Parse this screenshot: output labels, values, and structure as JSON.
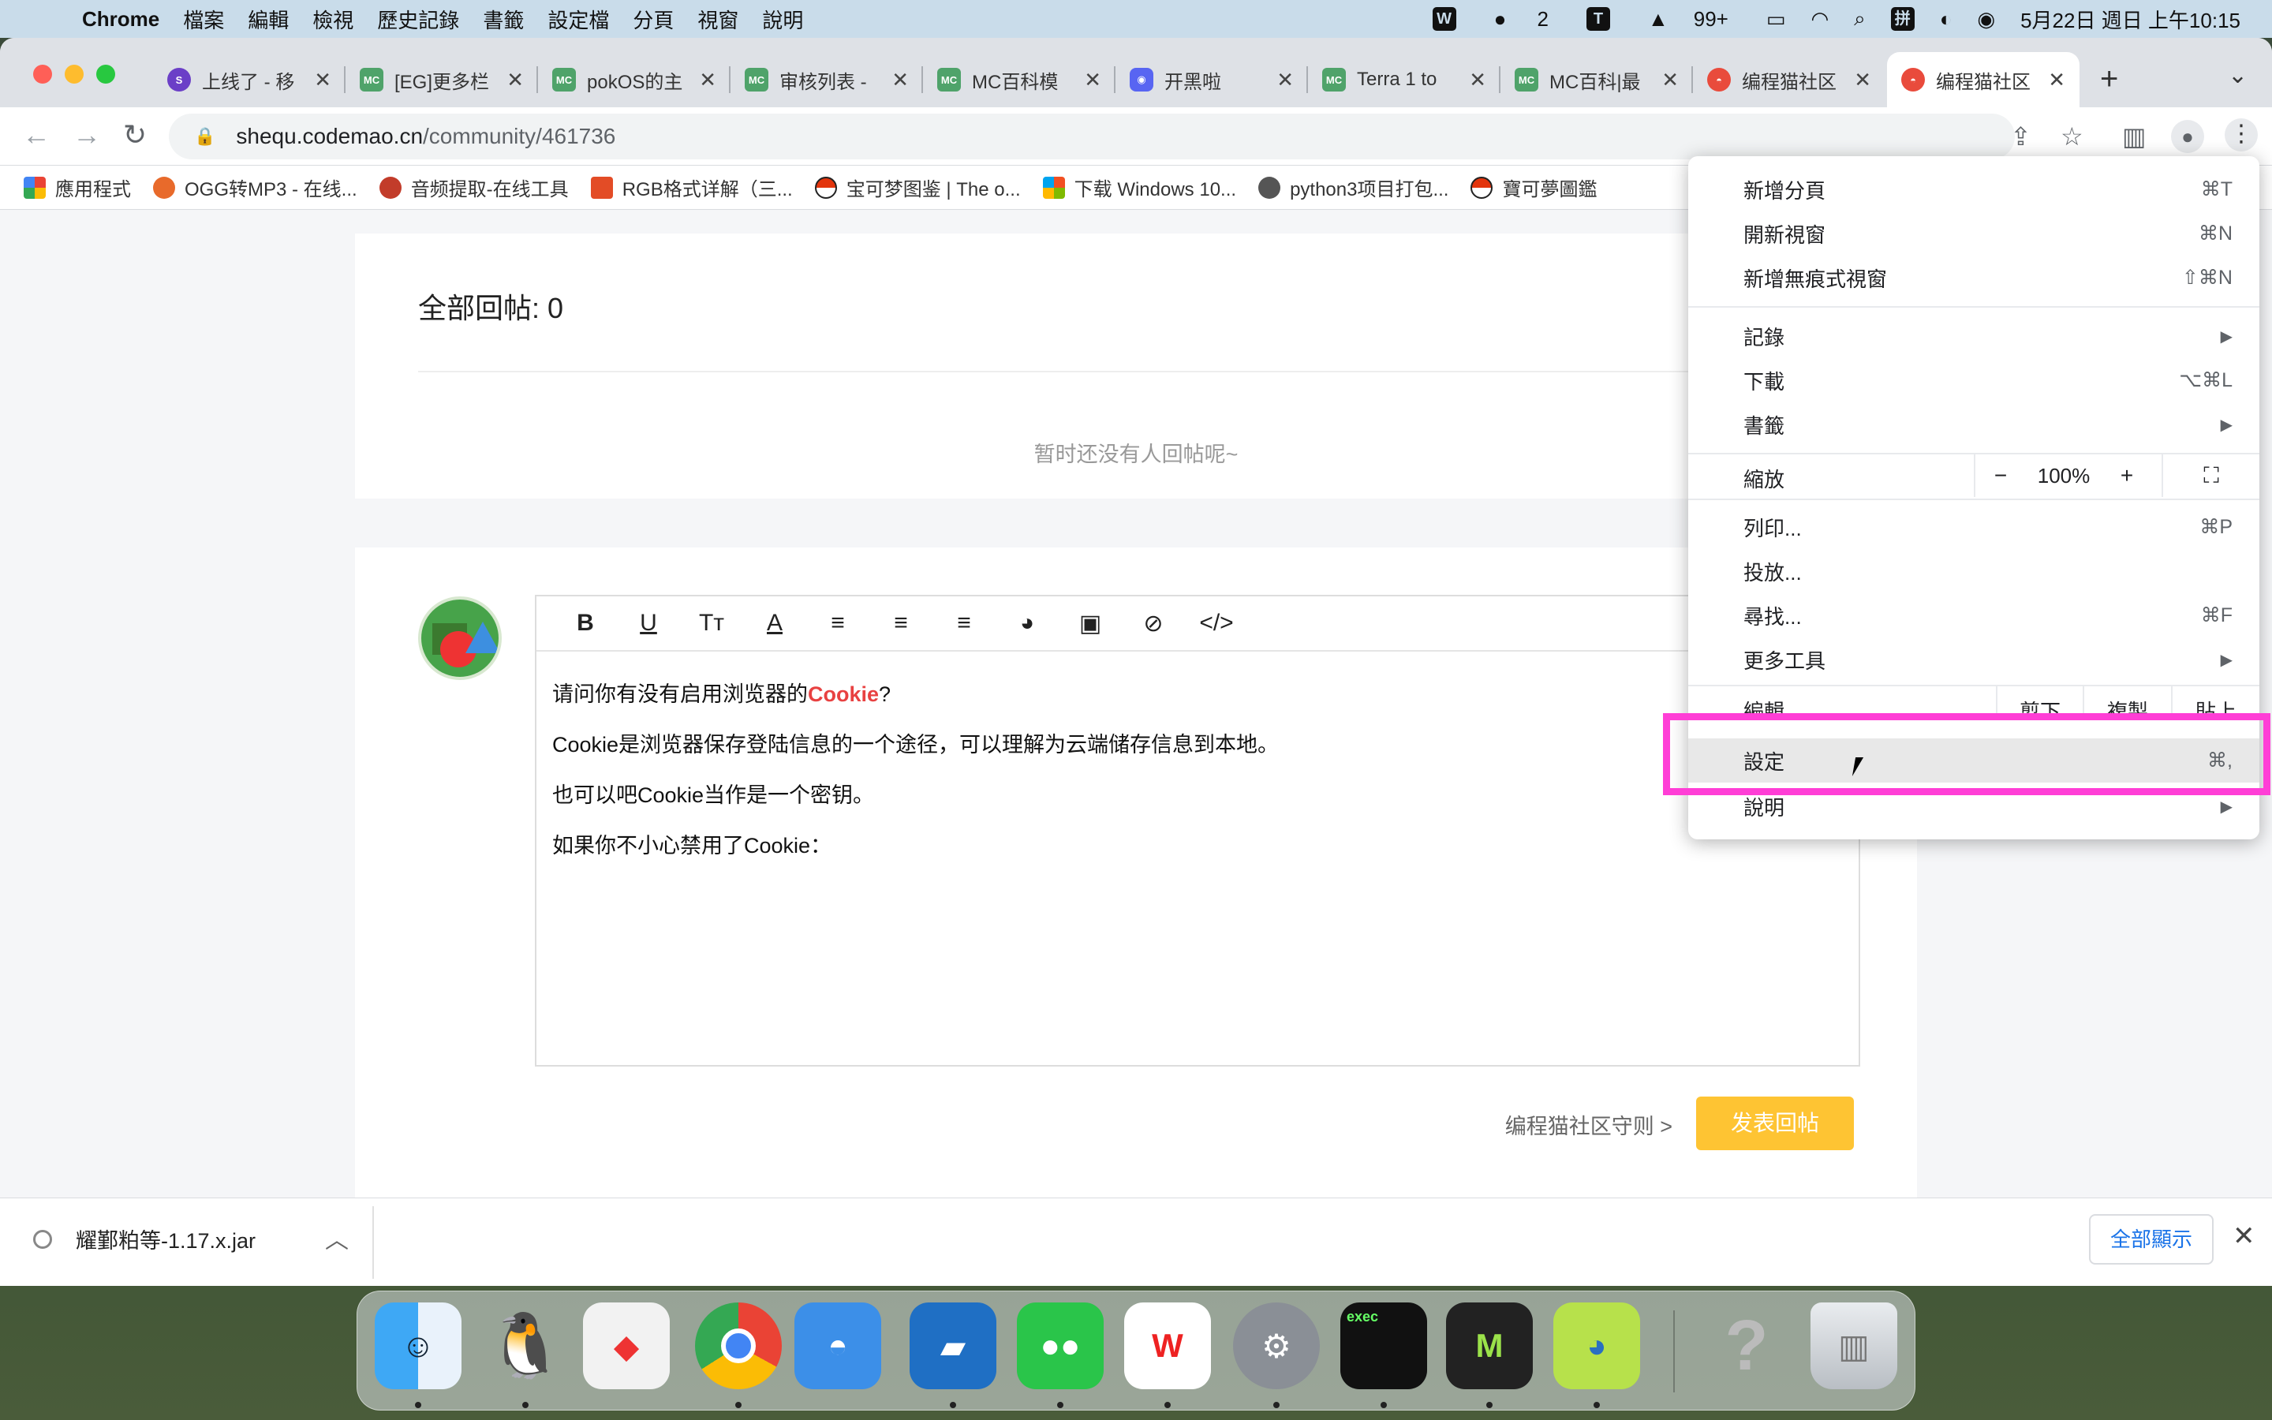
{
  "menubar": {
    "app": "Chrome",
    "items": [
      "檔案",
      "編輯",
      "檢視",
      "歷史記錄",
      "書籤",
      "設定檔",
      "分頁",
      "視窗",
      "說明"
    ],
    "wechat_count": "2",
    "qq_count": "99+",
    "ime": "拼",
    "clock": "5月22日 週日 上午10:15"
  },
  "tabs": [
    {
      "favicon": "s",
      "title": "上线了 - 移"
    },
    {
      "favicon": "MC",
      "title": "[EG]更多栏"
    },
    {
      "favicon": "MC",
      "title": "pokOS的主"
    },
    {
      "favicon": "MC",
      "title": "审核列表 -"
    },
    {
      "favicon": "MC",
      "title": "MC百科模"
    },
    {
      "favicon": "discord",
      "title": "开黑啦"
    },
    {
      "favicon": "MC",
      "title": "Terra 1 to"
    },
    {
      "favicon": "MC",
      "title": "MC百科|最"
    },
    {
      "favicon": "cat",
      "title": "编程猫社区"
    },
    {
      "favicon": "cat",
      "title": "编程猫社区"
    }
  ],
  "address": {
    "host": "shequ.codemao.cn",
    "path": "/community/461736"
  },
  "bookmarks": [
    {
      "icon": "apps",
      "label": "應用程式"
    },
    {
      "icon": "ogg",
      "label": "OGG转MP3 - 在线..."
    },
    {
      "icon": "mus",
      "label": "音频提取-在线工具"
    },
    {
      "icon": "rgb",
      "label": "RGB格式详解（三..."
    },
    {
      "icon": "poke",
      "label": "宝可梦图鉴 | The o..."
    },
    {
      "icon": "win",
      "label": "下载 Windows 10..."
    },
    {
      "icon": "py",
      "label": "python3项目打包..."
    },
    {
      "icon": "poke",
      "label": "寶可夢圖鑑"
    }
  ],
  "page": {
    "reply_count": "全部回帖: 0",
    "no_reply": "暂时还没有人回帖呢~",
    "editor": {
      "line1_pre": "请问你有没有启用浏览器的",
      "line1_kw": "Cookie",
      "line1_post": "?",
      "line2": "Cookie是浏览器保存登陆信息的一个途径，可以理解为云端储存信息到本地。",
      "line3": "也可以吧Cookie当作是一个密钥。",
      "line4": "如果你不小心禁用了Cookie："
    },
    "rules_link": "编程猫社区守则 >",
    "submit": "发表回帖"
  },
  "download": {
    "filename": "耀鄞粕等-1.17.x.jar",
    "show_all": "全部顯示"
  },
  "chrome_menu": {
    "new_tab": {
      "label": "新增分頁",
      "shortcut": "⌘T"
    },
    "new_window": {
      "label": "開新視窗",
      "shortcut": "⌘N"
    },
    "incognito": {
      "label": "新增無痕式視窗",
      "shortcut": "⇧⌘N"
    },
    "history": {
      "label": "記錄"
    },
    "downloads": {
      "label": "下載",
      "shortcut": "⌥⌘L"
    },
    "bookmarks": {
      "label": "書籤"
    },
    "zoom": {
      "label": "縮放",
      "minus": "−",
      "value": "100%",
      "plus": "+"
    },
    "print": {
      "label": "列印...",
      "shortcut": "⌘P"
    },
    "cast": {
      "label": "投放..."
    },
    "find": {
      "label": "尋找...",
      "shortcut": "⌘F"
    },
    "more_tools": {
      "label": "更多工具"
    },
    "edit": {
      "label": "編輯",
      "cut": "剪下",
      "copy": "複製",
      "paste": "貼上"
    },
    "settings": {
      "label": "設定",
      "shortcut": "⌘,"
    },
    "help": {
      "label": "說明"
    }
  },
  "highlight_color": "#ff3ed6",
  "accent_yellow": "#fec433"
}
